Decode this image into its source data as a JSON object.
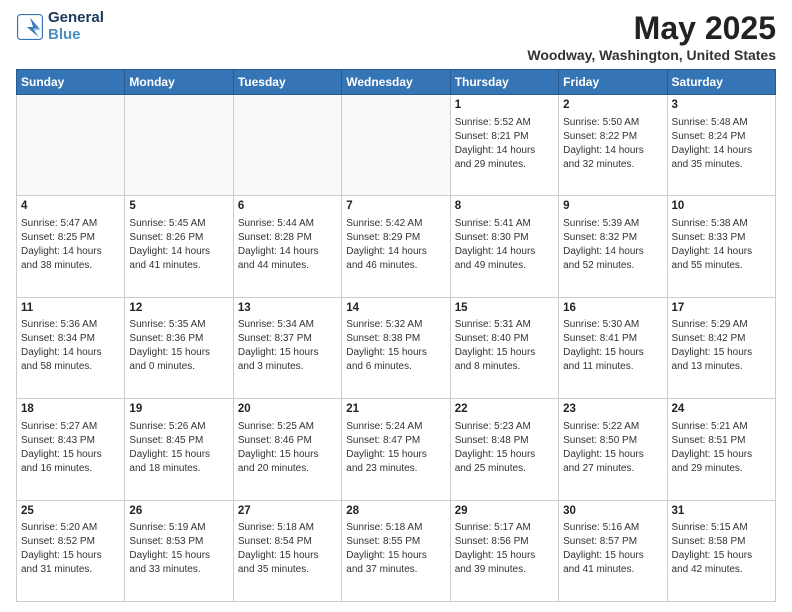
{
  "logo": {
    "line1": "General",
    "line2": "Blue"
  },
  "title": "May 2025",
  "subtitle": "Woodway, Washington, United States",
  "days_of_week": [
    "Sunday",
    "Monday",
    "Tuesday",
    "Wednesday",
    "Thursday",
    "Friday",
    "Saturday"
  ],
  "weeks": [
    [
      {
        "day": "",
        "info": ""
      },
      {
        "day": "",
        "info": ""
      },
      {
        "day": "",
        "info": ""
      },
      {
        "day": "",
        "info": ""
      },
      {
        "day": "1",
        "info": "Sunrise: 5:52 AM\nSunset: 8:21 PM\nDaylight: 14 hours\nand 29 minutes."
      },
      {
        "day": "2",
        "info": "Sunrise: 5:50 AM\nSunset: 8:22 PM\nDaylight: 14 hours\nand 32 minutes."
      },
      {
        "day": "3",
        "info": "Sunrise: 5:48 AM\nSunset: 8:24 PM\nDaylight: 14 hours\nand 35 minutes."
      }
    ],
    [
      {
        "day": "4",
        "info": "Sunrise: 5:47 AM\nSunset: 8:25 PM\nDaylight: 14 hours\nand 38 minutes."
      },
      {
        "day": "5",
        "info": "Sunrise: 5:45 AM\nSunset: 8:26 PM\nDaylight: 14 hours\nand 41 minutes."
      },
      {
        "day": "6",
        "info": "Sunrise: 5:44 AM\nSunset: 8:28 PM\nDaylight: 14 hours\nand 44 minutes."
      },
      {
        "day": "7",
        "info": "Sunrise: 5:42 AM\nSunset: 8:29 PM\nDaylight: 14 hours\nand 46 minutes."
      },
      {
        "day": "8",
        "info": "Sunrise: 5:41 AM\nSunset: 8:30 PM\nDaylight: 14 hours\nand 49 minutes."
      },
      {
        "day": "9",
        "info": "Sunrise: 5:39 AM\nSunset: 8:32 PM\nDaylight: 14 hours\nand 52 minutes."
      },
      {
        "day": "10",
        "info": "Sunrise: 5:38 AM\nSunset: 8:33 PM\nDaylight: 14 hours\nand 55 minutes."
      }
    ],
    [
      {
        "day": "11",
        "info": "Sunrise: 5:36 AM\nSunset: 8:34 PM\nDaylight: 14 hours\nand 58 minutes."
      },
      {
        "day": "12",
        "info": "Sunrise: 5:35 AM\nSunset: 8:36 PM\nDaylight: 15 hours\nand 0 minutes."
      },
      {
        "day": "13",
        "info": "Sunrise: 5:34 AM\nSunset: 8:37 PM\nDaylight: 15 hours\nand 3 minutes."
      },
      {
        "day": "14",
        "info": "Sunrise: 5:32 AM\nSunset: 8:38 PM\nDaylight: 15 hours\nand 6 minutes."
      },
      {
        "day": "15",
        "info": "Sunrise: 5:31 AM\nSunset: 8:40 PM\nDaylight: 15 hours\nand 8 minutes."
      },
      {
        "day": "16",
        "info": "Sunrise: 5:30 AM\nSunset: 8:41 PM\nDaylight: 15 hours\nand 11 minutes."
      },
      {
        "day": "17",
        "info": "Sunrise: 5:29 AM\nSunset: 8:42 PM\nDaylight: 15 hours\nand 13 minutes."
      }
    ],
    [
      {
        "day": "18",
        "info": "Sunrise: 5:27 AM\nSunset: 8:43 PM\nDaylight: 15 hours\nand 16 minutes."
      },
      {
        "day": "19",
        "info": "Sunrise: 5:26 AM\nSunset: 8:45 PM\nDaylight: 15 hours\nand 18 minutes."
      },
      {
        "day": "20",
        "info": "Sunrise: 5:25 AM\nSunset: 8:46 PM\nDaylight: 15 hours\nand 20 minutes."
      },
      {
        "day": "21",
        "info": "Sunrise: 5:24 AM\nSunset: 8:47 PM\nDaylight: 15 hours\nand 23 minutes."
      },
      {
        "day": "22",
        "info": "Sunrise: 5:23 AM\nSunset: 8:48 PM\nDaylight: 15 hours\nand 25 minutes."
      },
      {
        "day": "23",
        "info": "Sunrise: 5:22 AM\nSunset: 8:50 PM\nDaylight: 15 hours\nand 27 minutes."
      },
      {
        "day": "24",
        "info": "Sunrise: 5:21 AM\nSunset: 8:51 PM\nDaylight: 15 hours\nand 29 minutes."
      }
    ],
    [
      {
        "day": "25",
        "info": "Sunrise: 5:20 AM\nSunset: 8:52 PM\nDaylight: 15 hours\nand 31 minutes."
      },
      {
        "day": "26",
        "info": "Sunrise: 5:19 AM\nSunset: 8:53 PM\nDaylight: 15 hours\nand 33 minutes."
      },
      {
        "day": "27",
        "info": "Sunrise: 5:18 AM\nSunset: 8:54 PM\nDaylight: 15 hours\nand 35 minutes."
      },
      {
        "day": "28",
        "info": "Sunrise: 5:18 AM\nSunset: 8:55 PM\nDaylight: 15 hours\nand 37 minutes."
      },
      {
        "day": "29",
        "info": "Sunrise: 5:17 AM\nSunset: 8:56 PM\nDaylight: 15 hours\nand 39 minutes."
      },
      {
        "day": "30",
        "info": "Sunrise: 5:16 AM\nSunset: 8:57 PM\nDaylight: 15 hours\nand 41 minutes."
      },
      {
        "day": "31",
        "info": "Sunrise: 5:15 AM\nSunset: 8:58 PM\nDaylight: 15 hours\nand 42 minutes."
      }
    ]
  ]
}
